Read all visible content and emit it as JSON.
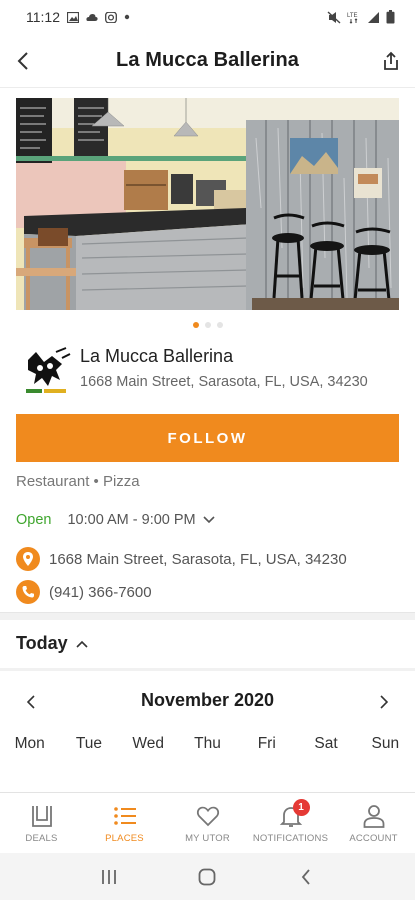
{
  "status_bar": {
    "time": "11:12",
    "left_icons": [
      "image-icon",
      "cloud-icon",
      "instagram-icon",
      "dot-icon"
    ],
    "right_icons": [
      "mute-icon",
      "lte-icon",
      "signal-icon",
      "battery-icon"
    ]
  },
  "header": {
    "title": "La Mucca Ballerina",
    "back_icon": "chevron-left-icon",
    "share_icon": "share-icon"
  },
  "carousel": {
    "image": "cafe-interior-photo",
    "page_count": 3,
    "active_index": 0
  },
  "business": {
    "name": "La Mucca Ballerina",
    "address": "1668 Main Street, Sarasota, FL, USA, 34230",
    "logo": "dancing-cow-logo"
  },
  "follow_button": "FOLLOW",
  "category": "Restaurant • Pizza",
  "hours": {
    "status": "Open",
    "range": "10:00 AM - 9:00 PM"
  },
  "contact": {
    "address": "1668 Main Street, Sarasota, FL, USA, 34230",
    "phone": "(941) 366-7600"
  },
  "schedule": {
    "label": "Today"
  },
  "calendar": {
    "month": "November 2020",
    "weekdays": [
      "Mon",
      "Tue",
      "Wed",
      "Thu",
      "Fri",
      "Sat",
      "Sun"
    ]
  },
  "bottom_nav": {
    "items": [
      {
        "label": "DEALS",
        "icon": "deals-icon"
      },
      {
        "label": "PLACES",
        "icon": "list-icon"
      },
      {
        "label": "MY UTOR",
        "icon": "heart-icon"
      },
      {
        "label": "NOTIFICATIONS",
        "icon": "bell-icon",
        "badge": "1"
      },
      {
        "label": "ACCOUNT",
        "icon": "person-icon"
      }
    ],
    "active": "PLACES"
  },
  "colors": {
    "accent": "#f08a1e",
    "open": "#3fa62e",
    "badge": "#e53935"
  }
}
